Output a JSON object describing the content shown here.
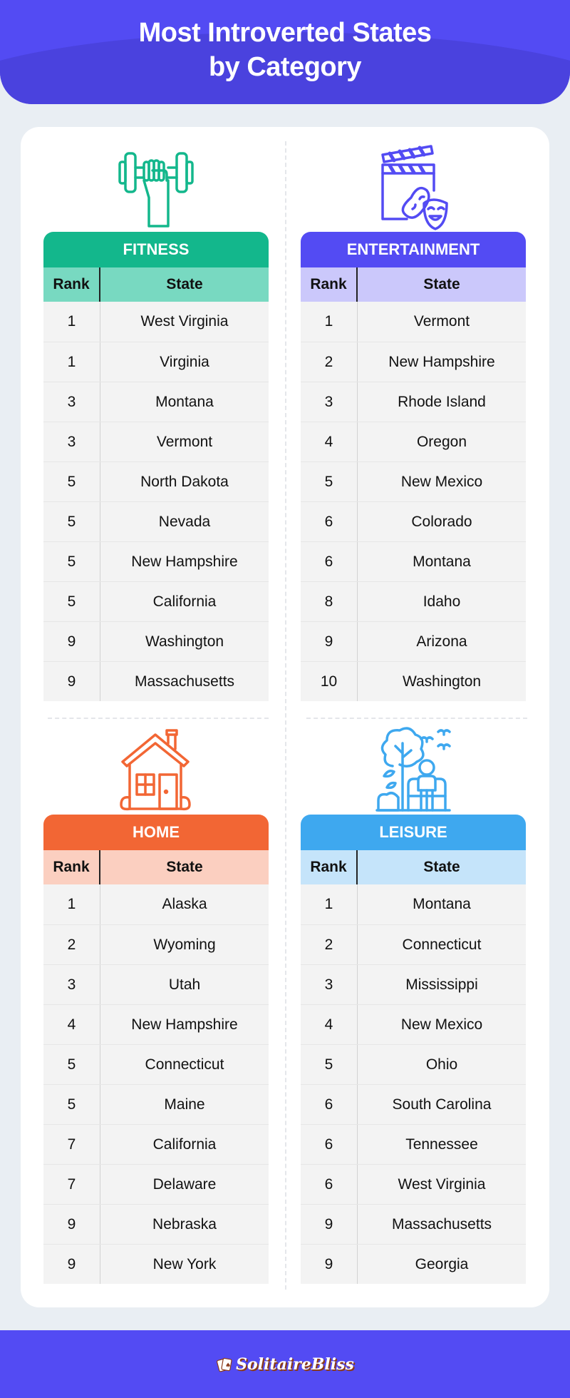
{
  "header": {
    "title_line1": "Most Introverted States",
    "title_line2": "by Category"
  },
  "colors": {
    "brand": "#534bf3",
    "fitness": "#13b78c",
    "fitness_light": "#78d9c1",
    "entertainment": "#534bf3",
    "entertainment_light": "#cbc8fb",
    "home": "#f26634",
    "home_light": "#fbcfc0",
    "leisure": "#3ea8ef",
    "leisure_light": "#c5e4fa"
  },
  "column_headers": {
    "rank": "Rank",
    "state": "State"
  },
  "categories": {
    "fitness": {
      "title": "FITNESS",
      "icon": "dumbbell-fist-icon",
      "rows": [
        {
          "rank": "1",
          "state": "West Virginia"
        },
        {
          "rank": "1",
          "state": "Virginia"
        },
        {
          "rank": "3",
          "state": "Montana"
        },
        {
          "rank": "3",
          "state": "Vermont"
        },
        {
          "rank": "5",
          "state": "North Dakota"
        },
        {
          "rank": "5",
          "state": "Nevada"
        },
        {
          "rank": "5",
          "state": "New Hampshire"
        },
        {
          "rank": "5",
          "state": "California"
        },
        {
          "rank": "9",
          "state": "Washington"
        },
        {
          "rank": "9",
          "state": "Massachusetts"
        }
      ]
    },
    "entertainment": {
      "title": "ENTERTAINMENT",
      "icon": "clapperboard-masks-icon",
      "rows": [
        {
          "rank": "1",
          "state": "Vermont"
        },
        {
          "rank": "2",
          "state": "New Hampshire"
        },
        {
          "rank": "3",
          "state": "Rhode Island"
        },
        {
          "rank": "4",
          "state": "Oregon"
        },
        {
          "rank": "5",
          "state": "New Mexico"
        },
        {
          "rank": "6",
          "state": "Colorado"
        },
        {
          "rank": "6",
          "state": "Montana"
        },
        {
          "rank": "8",
          "state": "Idaho"
        },
        {
          "rank": "9",
          "state": "Arizona"
        },
        {
          "rank": "10",
          "state": "Washington"
        }
      ]
    },
    "home": {
      "title": "HOME",
      "icon": "house-icon",
      "rows": [
        {
          "rank": "1",
          "state": "Alaska"
        },
        {
          "rank": "2",
          "state": "Wyoming"
        },
        {
          "rank": "3",
          "state": "Utah"
        },
        {
          "rank": "4",
          "state": "New Hampshire"
        },
        {
          "rank": "5",
          "state": "Connecticut"
        },
        {
          "rank": "5",
          "state": "Maine"
        },
        {
          "rank": "7",
          "state": "California"
        },
        {
          "rank": "7",
          "state": "Delaware"
        },
        {
          "rank": "9",
          "state": "Nebraska"
        },
        {
          "rank": "9",
          "state": "New York"
        }
      ]
    },
    "leisure": {
      "title": "LEISURE",
      "icon": "park-bench-icon",
      "rows": [
        {
          "rank": "1",
          "state": "Montana"
        },
        {
          "rank": "2",
          "state": "Connecticut"
        },
        {
          "rank": "3",
          "state": "Mississippi"
        },
        {
          "rank": "4",
          "state": "New Mexico"
        },
        {
          "rank": "5",
          "state": "Ohio"
        },
        {
          "rank": "6",
          "state": "South Carolina"
        },
        {
          "rank": "6",
          "state": "Tennessee"
        },
        {
          "rank": "6",
          "state": "West Virginia"
        },
        {
          "rank": "9",
          "state": "Massachusetts"
        },
        {
          "rank": "9",
          "state": "Georgia"
        }
      ]
    }
  },
  "footer": {
    "logo_text": "SolitaireBliss",
    "logo_icon": "playing-cards-icon"
  }
}
